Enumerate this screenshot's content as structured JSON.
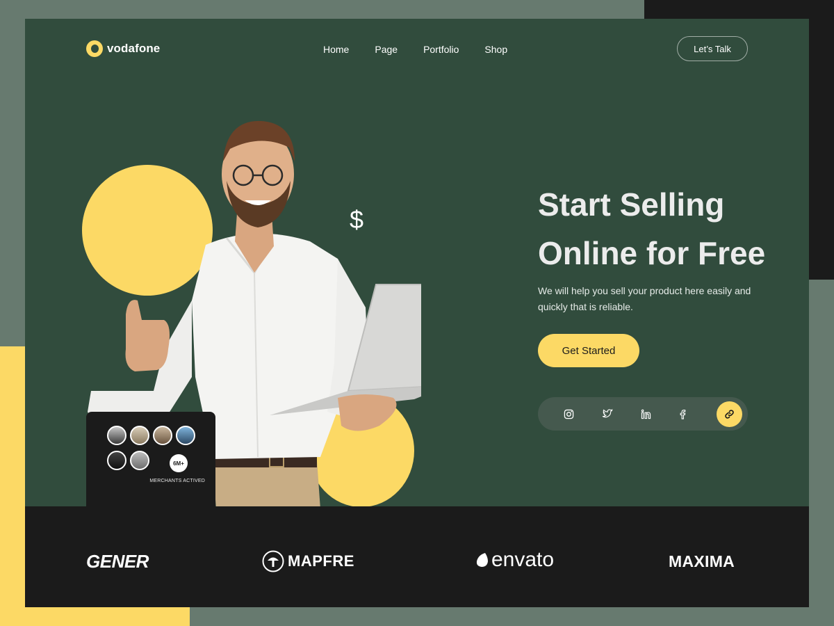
{
  "brand": {
    "name": "vodafone",
    "logo_icon": "vodafone-logo-icon"
  },
  "nav": {
    "items": [
      "Home",
      "Page",
      "Portfolio",
      "Shop"
    ]
  },
  "header": {
    "cta_label": "Let’s Talk"
  },
  "hero": {
    "title_line1": "Start Selling",
    "title_line2": "Online for Free",
    "description": "We will help you sell your product here easily and quickly that is reliable.",
    "cta_label": "Get Started",
    "decor_symbol": "$"
  },
  "merchants": {
    "count": "6M+",
    "label": "MERCHANTS ACTIVED",
    "avatars": 6
  },
  "social": {
    "icons": [
      "instagram-icon",
      "twitter-icon",
      "linkedin-icon",
      "facebook-icon",
      "link-icon"
    ]
  },
  "partners": {
    "logos": [
      "GENER",
      "MAPFRE",
      "envato",
      "MAXIMA"
    ]
  },
  "colors": {
    "background": "#677a6f",
    "card": "#314c3d",
    "accent_yellow": "#fcd965",
    "dark": "#1b1b1b",
    "text_light": "#ececec"
  }
}
